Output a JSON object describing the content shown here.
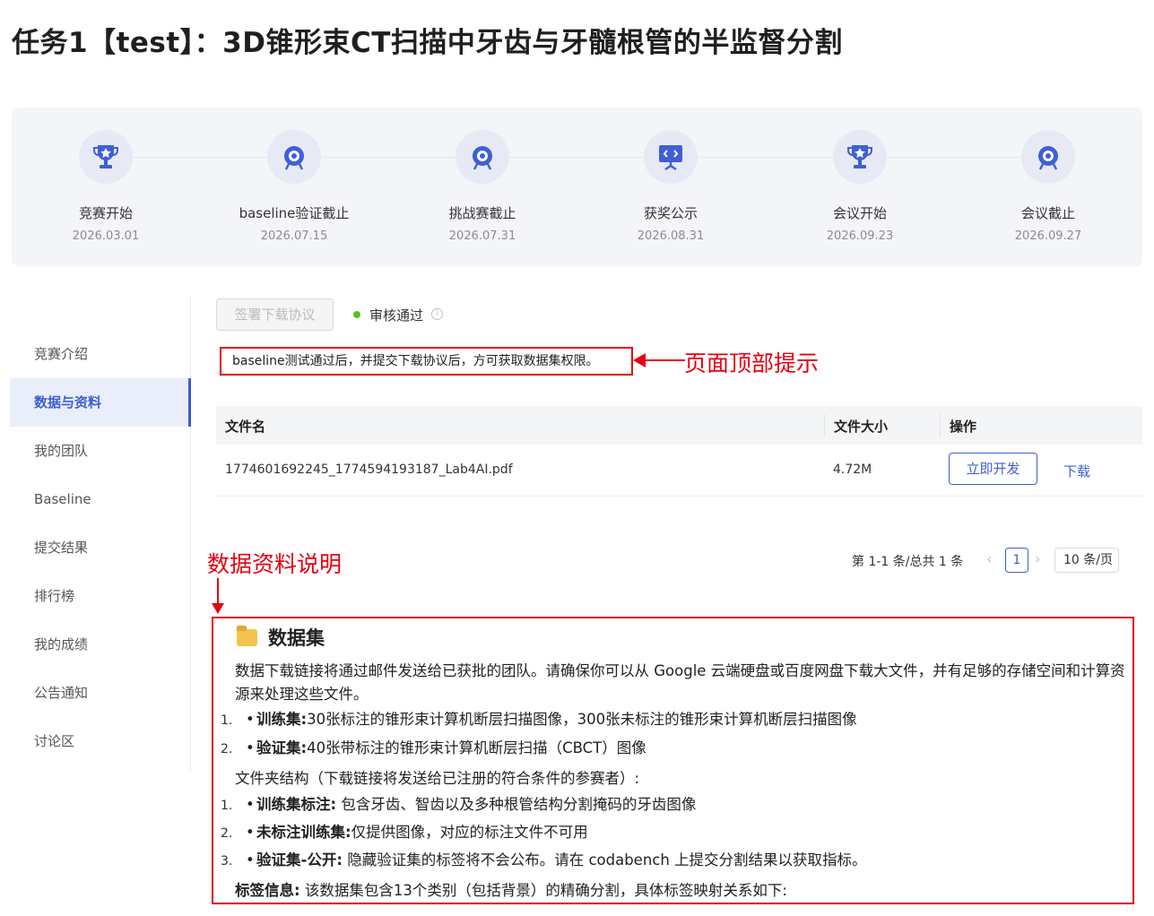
{
  "page": {
    "title": "任务1【test】：3D锥形束CT扫描中牙齿与牙髓根管的半监督分割"
  },
  "timeline": [
    {
      "label": "竞赛开始",
      "date": "2026.03.01",
      "icon": "trophy-icon"
    },
    {
      "label": "baseline验证截止",
      "date": "2026.07.15",
      "icon": "target-icon"
    },
    {
      "label": "挑战赛截止",
      "date": "2026.07.31",
      "icon": "target-icon"
    },
    {
      "label": "获奖公示",
      "date": "2026.08.31",
      "icon": "presentation-board-icon"
    },
    {
      "label": "会议开始",
      "date": "2026.09.23",
      "icon": "trophy-icon"
    },
    {
      "label": "会议截止",
      "date": "2026.09.27",
      "icon": "target-icon"
    }
  ],
  "sidebar": {
    "items": [
      {
        "label": "竞赛介绍",
        "active": false
      },
      {
        "label": "数据与资料",
        "active": true
      },
      {
        "label": "我的团队",
        "active": false
      },
      {
        "label": "Baseline",
        "active": false
      },
      {
        "label": "提交结果",
        "active": false
      },
      {
        "label": "排行榜",
        "active": false
      },
      {
        "label": "我的成绩",
        "active": false
      },
      {
        "label": "公告通知",
        "active": false
      },
      {
        "label": "讨论区",
        "active": false
      }
    ]
  },
  "toolbar": {
    "sign_label": "签署下载协议",
    "status": "审核通过",
    "status_color": "#52c41a"
  },
  "notice": {
    "text": "baseline测试通过后，并提交下载协议后，方可获取数据集权限。"
  },
  "annotations": {
    "top_hint": "页面顶部提示",
    "data_desc": "数据资料说明"
  },
  "table": {
    "headers": [
      "文件名",
      "文件大小",
      "操作"
    ],
    "rows": [
      {
        "name": "1774601692245_1774594193187_Lab4AI.pdf",
        "size": "4.72M",
        "action_primary": "立即开发",
        "action_link": "下载"
      }
    ]
  },
  "pagination": {
    "total": "第 1-1 条/总共 1 条",
    "current": "1",
    "page_size": "10 条/页"
  },
  "dataset": {
    "title": "数据集",
    "intro": "数据下载链接将通过邮件发送给已获批的团队。请确保你可以从 Google 云端硬盘或百度网盘下载大文件，并有足够的存储空间和计算资源来处理这些文件。",
    "list1": [
      {
        "num": "1.",
        "label": "训练集:",
        "text": "30张标注的锥形束计算机断层扫描图像，300张未标注的锥形束计算机断层扫描图像"
      },
      {
        "num": "2.",
        "label": "验证集:",
        "text": "40张带标注的锥形束计算机断层扫描（CBCT）图像"
      }
    ],
    "folder_intro": "文件夹结构（下载链接将发送给已注册的符合条件的参赛者）:",
    "list2": [
      {
        "num": "1.",
        "label": "训练集标注:",
        "text": " 包含牙齿、智齿以及多种根管结构分割掩码的牙齿图像"
      },
      {
        "num": "2.",
        "label": "未标注训练集:",
        "text": "仅提供图像，对应的标注文件不可用"
      },
      {
        "num": "3.",
        "label": "验证集-公开:",
        "text": " 隐藏验证集的标签将不会公布。请在 codabench 上提交分割结果以获取指标。"
      }
    ],
    "label_info_label": "标签信息:",
    "label_info_text": " 该数据集包含13个类别（包括背景）的精确分割，具体标签映射关系如下:"
  },
  "colors": {
    "accent": "#3c5fd1",
    "annotation": "#e60012",
    "icon": "#3f5fd6"
  }
}
